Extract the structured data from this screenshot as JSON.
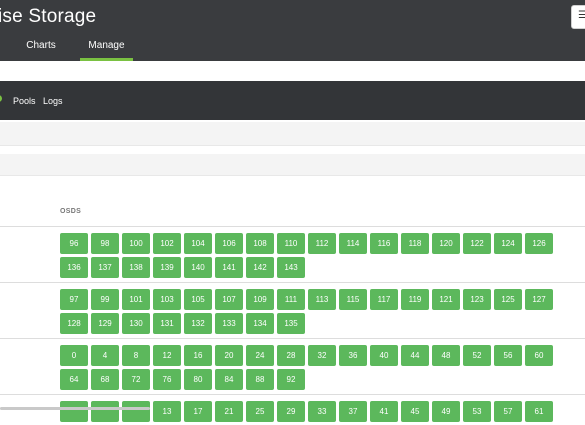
{
  "header": {
    "title": "ise Storage",
    "tabs": [
      {
        "label": "Charts"
      },
      {
        "label": "Manage"
      }
    ],
    "menu_icon": "list-icon"
  },
  "subnav": {
    "items": [
      {
        "label": "Pools"
      },
      {
        "label": "Logs"
      }
    ]
  },
  "osds": {
    "header": "OSDS",
    "groups": [
      [
        [
          "96",
          "98",
          "100",
          "102",
          "104",
          "106",
          "108",
          "110",
          "112",
          "114",
          "116",
          "118",
          "120",
          "122",
          "124",
          "126"
        ],
        [
          "136",
          "137",
          "138",
          "139",
          "140",
          "141",
          "142",
          "143"
        ]
      ],
      [
        [
          "97",
          "99",
          "101",
          "103",
          "105",
          "107",
          "109",
          "111",
          "113",
          "115",
          "117",
          "119",
          "121",
          "123",
          "125",
          "127"
        ],
        [
          "128",
          "129",
          "130",
          "131",
          "132",
          "133",
          "134",
          "135"
        ]
      ],
      [
        [
          "0",
          "4",
          "8",
          "12",
          "16",
          "20",
          "24",
          "28",
          "32",
          "36",
          "40",
          "44",
          "48",
          "52",
          "56",
          "60"
        ],
        [
          "64",
          "68",
          "72",
          "76",
          "80",
          "84",
          "88",
          "92"
        ]
      ],
      [
        [
          "",
          "",
          "",
          "13",
          "17",
          "21",
          "25",
          "29",
          "33",
          "37",
          "41",
          "45",
          "49",
          "53",
          "57",
          "61"
        ]
      ]
    ]
  },
  "colors": {
    "topbar": "#3a3c3f",
    "subbar": "#333538",
    "accent": "#7ac142",
    "osd_button": "#5cb85c"
  }
}
